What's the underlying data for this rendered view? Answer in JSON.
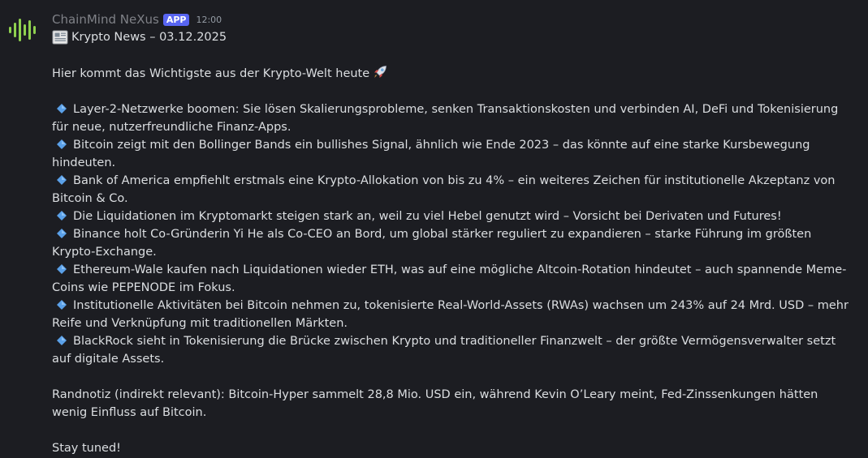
{
  "message": {
    "author": "ChainMind NeXus",
    "badge": "APP",
    "timestamp": "12:00",
    "avatar_icon": "soundwave-icon",
    "title": "Krypto News – 03.12.2025",
    "title_icon": "newspaper-icon",
    "intro": "Hier kommt das Wichtigste aus der Krypto-Welt heute",
    "intro_icon": "rocket-icon",
    "bullet_icon": "blue-diamond-icon",
    "bullets": [
      "Layer-2-Netzwerke boomen: Sie lösen Skalierungsprobleme, senken Transaktionskosten und verbinden AI, DeFi und Tokenisierung für neue, nutzerfreundliche Finanz-Apps.",
      "Bitcoin zeigt mit den Bollinger Bands ein bullishes Signal, ähnlich wie Ende 2023 – das könnte auf eine starke Kursbewegung hindeuten.",
      "Bank of America empfiehlt erstmals eine Krypto-Allokation von bis zu 4% – ein weiteres Zeichen für institutionelle Akzeptanz von Bitcoin & Co.",
      "Die Liquidationen im Kryptomarkt steigen stark an, weil zu viel Hebel genutzt wird – Vorsicht bei Derivaten und Futures!",
      "Binance holt Co-Gründerin Yi He als Co-CEO an Bord, um global stärker reguliert zu expandieren – starke Führung im größten Krypto-Exchange.",
      "Ethereum-Wale kaufen nach Liquidationen wieder ETH, was auf eine mögliche Altcoin-Rotation hindeutet – auch spannende Meme-Coins wie PEPENODE im Fokus.",
      "Institutionelle Aktivitäten bei Bitcoin nehmen zu, tokenisierte Real-World-Assets (RWAs) wachsen um 243% auf 24 Mrd. USD – mehr Reife und Verknüpfung mit traditionellen Märkten.",
      "BlackRock sieht in Tokenisierung die Brücke zwischen Krypto und traditioneller Finanzwelt – der größte Vermögensverwalter setzt auf digitale Assets."
    ],
    "side_note": "Randnotiz (indirekt relevant): Bitcoin-Hyper sammelt 28,8 Mio. USD ein, während Kevin O’Leary meint, Fed-Zinssenkungen hätten wenig Einfluss auf Bitcoin.",
    "closing": "Stay tuned!"
  },
  "colors": {
    "background": "#1c1d22",
    "text": "#dbdee1",
    "username": "#7f8187",
    "badge": "#5865f2",
    "avatar_wave": "#8fd14f",
    "diamond": "#5aa0e8"
  }
}
